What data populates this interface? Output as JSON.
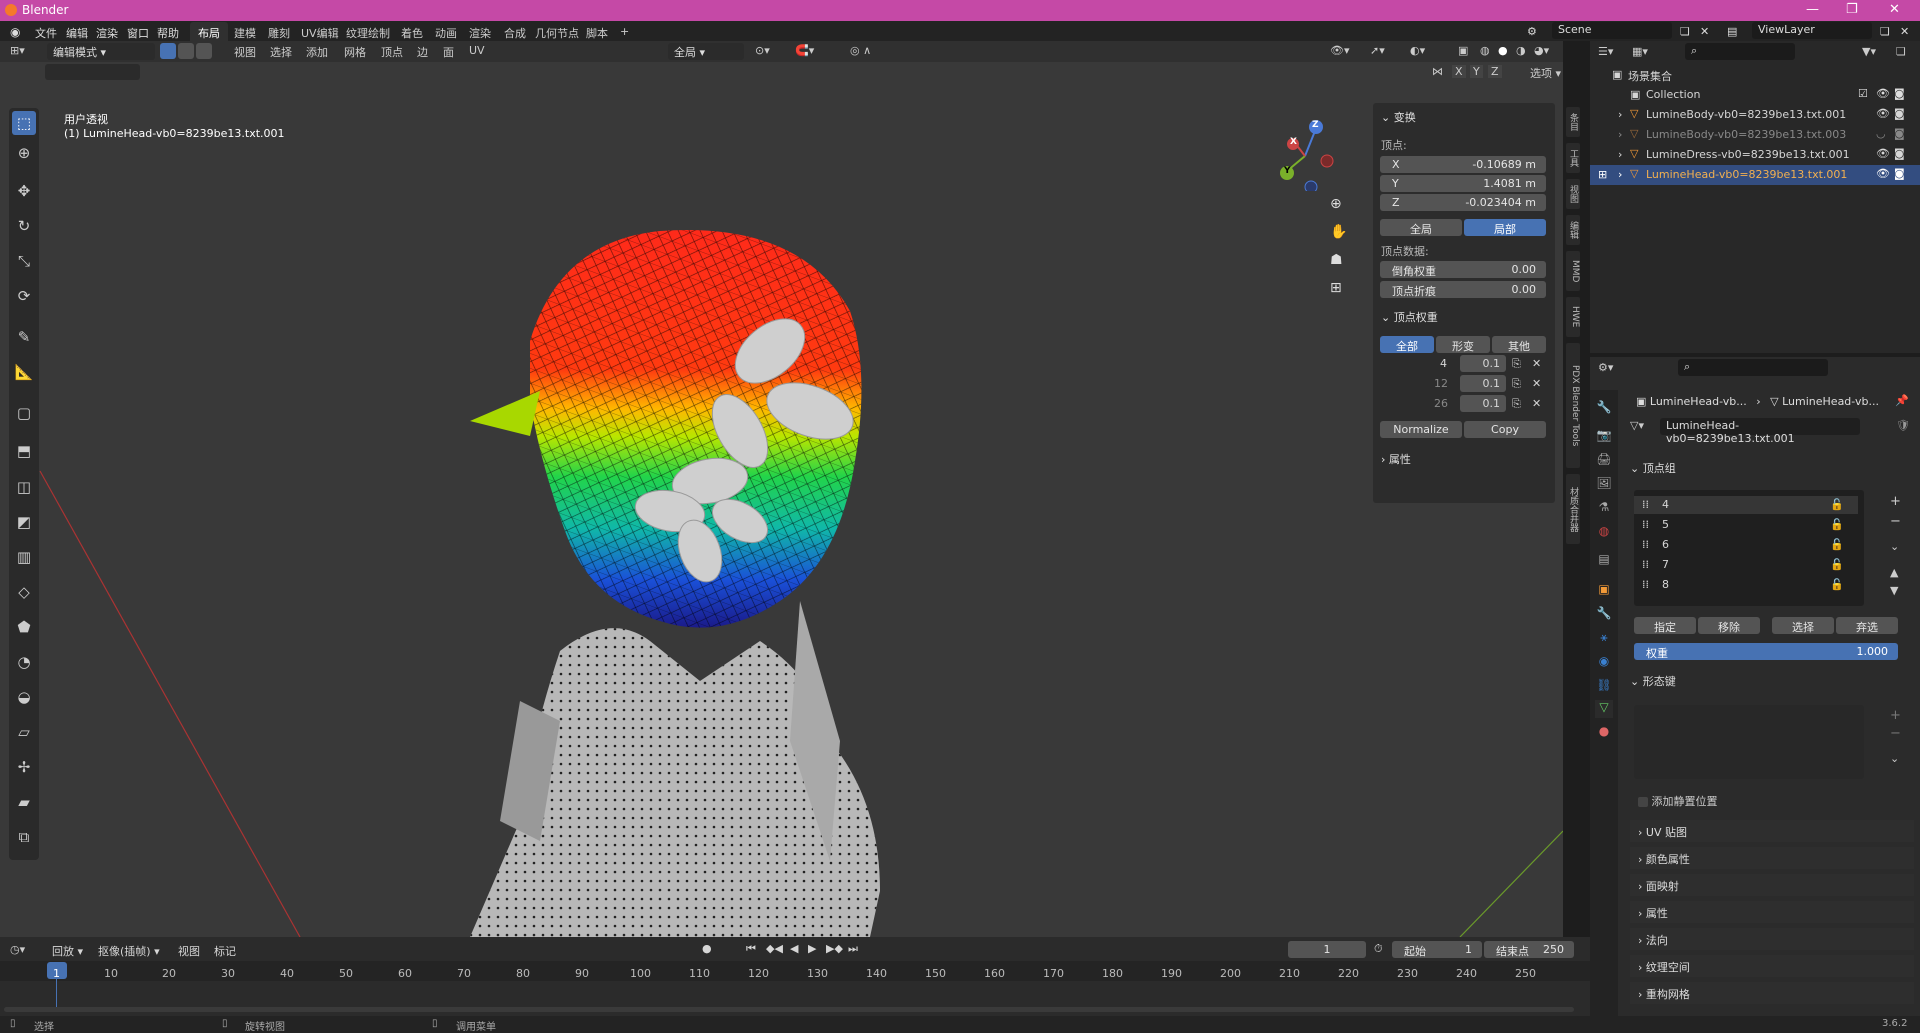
{
  "app": {
    "title": "Blender",
    "version": "3.6.2"
  },
  "menu": {
    "items": [
      "文件",
      "编辑",
      "渲染",
      "窗口",
      "帮助"
    ]
  },
  "workspaces": [
    "布局",
    "建模",
    "雕刻",
    "UV编辑",
    "纹理绘制",
    "着色",
    "动画",
    "渲染",
    "合成",
    "几何节点",
    "脚本"
  ],
  "workspace_add": "+",
  "scene": {
    "label": "Scene",
    "viewlayer": "ViewLayer"
  },
  "viewport_header": {
    "mode": "编辑模式",
    "menus": [
      "视图",
      "选择",
      "添加",
      "网格",
      "顶点",
      "边",
      "面",
      "UV"
    ],
    "transform_orientation": "全局",
    "options": "选项",
    "axes": [
      "X",
      "Y",
      "Z"
    ]
  },
  "viewport": {
    "view_name": "用户透视",
    "object_name": "(1) LumineHead-vb0=8239be13.txt.001"
  },
  "gizmo": {
    "z": "Z",
    "y": "Y",
    "x": "X"
  },
  "npanel": {
    "transform_title": "变换",
    "vertex_label": "顶点:",
    "coords": [
      {
        "axis": "X",
        "value": "-0.10689 m"
      },
      {
        "axis": "Y",
        "value": "1.4081 m"
      },
      {
        "axis": "Z",
        "value": "-0.023404 m"
      }
    ],
    "global_btn": "全局",
    "local_btn": "局部",
    "vertex_data_label": "顶点数据:",
    "bevel_weight": {
      "label": "倒角权重",
      "value": "0.00"
    },
    "crease": {
      "label": "顶点折痕",
      "value": "0.00"
    },
    "vweights_title": "顶点权重",
    "vw_tabs": [
      "全部",
      "形变",
      "其他"
    ],
    "vw_rows": [
      {
        "group": "4",
        "weight": "0.1"
      },
      {
        "group": "12",
        "weight": "0.1"
      },
      {
        "group": "26",
        "weight": "0.1"
      }
    ],
    "normalize": "Normalize",
    "copy": "Copy",
    "attr_title": "属性"
  },
  "side_tabs": [
    "条目",
    "工具",
    "视图",
    "编辑",
    "MMD",
    "HWE",
    "PDX Blender Tools",
    "材质合并器"
  ],
  "outliner": {
    "scene_collection": "场景集合",
    "collection": "Collection",
    "objects": [
      {
        "name": "LumineBody-vb0=8239be13.txt.001",
        "dim": false,
        "selected": false
      },
      {
        "name": "LumineBody-vb0=8239be13.txt.003",
        "dim": true,
        "selected": false
      },
      {
        "name": "LumineDress-vb0=8239be13.txt.001",
        "dim": false,
        "selected": false
      },
      {
        "name": "LumineHead-vb0=8239be13.txt.001",
        "dim": false,
        "selected": true
      }
    ]
  },
  "properties": {
    "breadcrumb1": "LumineHead-vb...",
    "breadcrumb2": "LumineHead-vb...",
    "mesh_name": "LumineHead-vb0=8239be13.txt.001",
    "vgroups_title": "顶点组",
    "vgroups": [
      "4",
      "5",
      "6",
      "7",
      "8"
    ],
    "assign": "指定",
    "remove": "移除",
    "select": "选择",
    "deselect": "弃选",
    "weight_label": "权重",
    "weight_value": "1.000",
    "shapekeys_title": "形态键",
    "add_rest": "添加静置位置",
    "sections": [
      "UV 贴图",
      "颜色属性",
      "面映射",
      "属性",
      "法向",
      "纹理空间",
      "重构网格"
    ]
  },
  "timeline": {
    "menus": [
      "回放",
      "抠像(插帧)",
      "视图",
      "标记"
    ],
    "current_frame": "1",
    "start_label": "起始",
    "start": "1",
    "end_label": "结束点",
    "end": "250",
    "frames": [
      "1",
      "10",
      "20",
      "30",
      "40",
      "50",
      "60",
      "70",
      "80",
      "90",
      "100",
      "110",
      "120",
      "130",
      "140",
      "150",
      "160",
      "170",
      "180",
      "190",
      "200",
      "210",
      "220",
      "230",
      "240",
      "250"
    ]
  },
  "status": {
    "select": "选择",
    "rotate": "旋转视图",
    "menu": "调用菜单"
  },
  "colors": {
    "accent": "#4772b3",
    "titlebar": "#c549a6"
  }
}
